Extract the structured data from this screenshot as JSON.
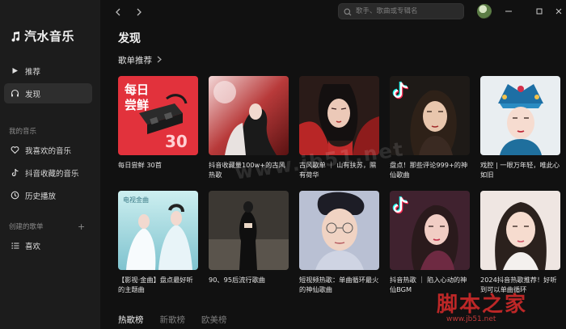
{
  "app": {
    "name": "汽水音乐"
  },
  "sidebar": {
    "nav": [
      {
        "label": "推荐",
        "icon": "play-icon"
      },
      {
        "label": "发现",
        "icon": "headphones-icon",
        "active": true
      }
    ],
    "my_music_label": "我的音乐",
    "my_music": [
      {
        "label": "我喜欢的音乐",
        "icon": "heart-icon"
      },
      {
        "label": "抖音收藏的音乐",
        "icon": "tiktok-icon"
      },
      {
        "label": "历史播放",
        "icon": "clock-icon"
      }
    ],
    "created_label": "创建的歌单",
    "created_add": "+",
    "created": [
      {
        "label": "喜欢",
        "icon": "list-icon"
      }
    ]
  },
  "topbar": {
    "search_placeholder": "歌手、歌曲或专辑名"
  },
  "main": {
    "title": "发现",
    "section_title": "歌单推荐",
    "cards": [
      {
        "title": "每日尝鲜 30首",
        "cover_text1": "每日",
        "cover_text2": "尝鲜",
        "cover_num": "30"
      },
      {
        "title": "抖音收藏量100w+的古风热歌"
      },
      {
        "title": "古风歌单 ｜ 山有扶苏，隰有荷华"
      },
      {
        "title": "盘点！那些评论999+的神仙歌曲"
      },
      {
        "title": "戏腔 | 一眼万年轻，唯此心如旧"
      },
      {
        "title": "【影视·金曲】盘点最好听的主题曲",
        "cover_caption": "电视金曲"
      },
      {
        "title": "90、95后流行歌曲"
      },
      {
        "title": "短视频热歌：单曲循环最火的神仙歌曲"
      },
      {
        "title": "抖音热歌 ｜ 陷入心动的神仙BGM"
      },
      {
        "title": "2024抖音热歌推荐！好听到可以单曲循环"
      }
    ],
    "tabs": [
      {
        "label": "热歌榜",
        "active": true
      },
      {
        "label": "新歌榜"
      },
      {
        "label": "欧美榜"
      }
    ]
  },
  "watermarks": {
    "site": "脚本之家",
    "url": "www.jb51.net",
    "center": "www.jb51.net"
  },
  "colors": {
    "background": "#111111",
    "sidebar": "#1c1c1c",
    "accent_red": "#e2323c"
  }
}
